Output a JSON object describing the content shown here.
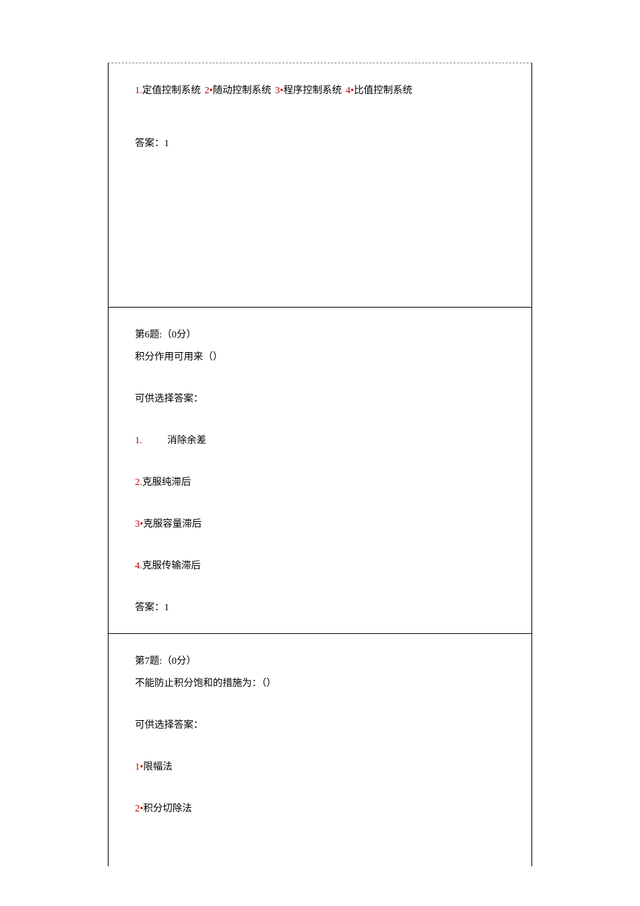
{
  "q5": {
    "options": [
      {
        "num": "1.",
        "text": "定值控制系统"
      },
      {
        "num": "2•",
        "text": "随动控制系统"
      },
      {
        "num": "3•",
        "text": "程序控制系统"
      },
      {
        "num": "4•",
        "text": "比值控制系统"
      }
    ],
    "answer_label": "答案：",
    "answer_value": "1"
  },
  "q6": {
    "header": "第6题:（0分）",
    "stem": "积分作用可用来（）",
    "choice_label": "可供选择答案：",
    "options": [
      {
        "num": "1.",
        "text": "消除余差",
        "indent": true
      },
      {
        "num": "2.",
        "text": "克服纯滞后"
      },
      {
        "num": "3•",
        "text": "克服容量滞后"
      },
      {
        "num": "4.",
        "text": "克服传输滞后"
      }
    ],
    "answer_label": "答案：",
    "answer_value": "1"
  },
  "q7": {
    "header": "第7题:（0分）",
    "stem": "不能防止积分饱和的措施为：（）",
    "choice_label": "可供选择答案：",
    "options": [
      {
        "num": "1•",
        "text": "限幅法"
      },
      {
        "num": "2•",
        "text": "积分切除法"
      }
    ]
  }
}
